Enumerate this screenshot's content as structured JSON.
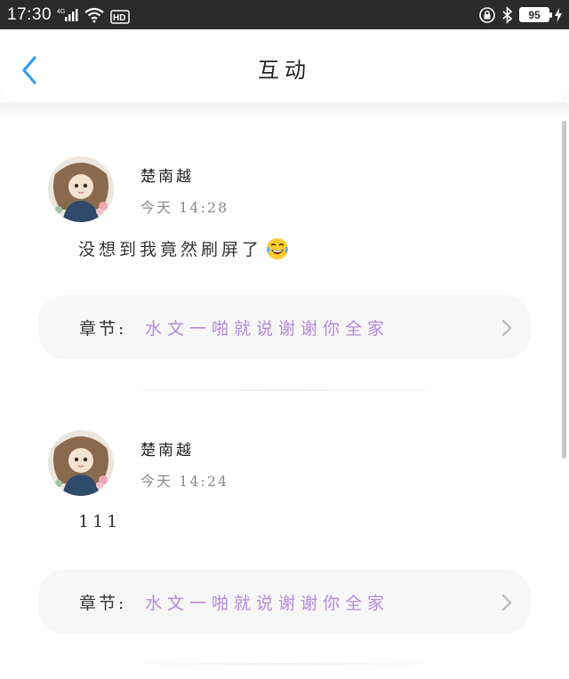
{
  "status_bar": {
    "time": "17:30",
    "network_label": "4G",
    "hd_label": "HD",
    "battery_level": "95",
    "icons": [
      "signal-icon",
      "wifi-icon",
      "hd-icon",
      "lock-rotation-icon",
      "bluetooth-icon",
      "battery-icon",
      "charging-icon"
    ]
  },
  "header": {
    "title": "互动",
    "back_icon": "chevron-left-icon"
  },
  "colors": {
    "accent_blue": "#2f9bef",
    "chapter_purple": "#b48ad9",
    "status_bar_bg": "#2b2b2b"
  },
  "comments": [
    {
      "username": "楚南越",
      "timestamp": "今天 14:28",
      "text": "没想到我竟然刷屏了",
      "emoji": "tears-of-joy-emoji",
      "chapter_label": "章节:",
      "chapter_title": "水文一啪就说谢谢你全家"
    },
    {
      "username": "楚南越",
      "timestamp": "今天 14:24",
      "text": "111",
      "chapter_label": "章节:",
      "chapter_title": "水文一啪就说谢谢你全家"
    }
  ]
}
